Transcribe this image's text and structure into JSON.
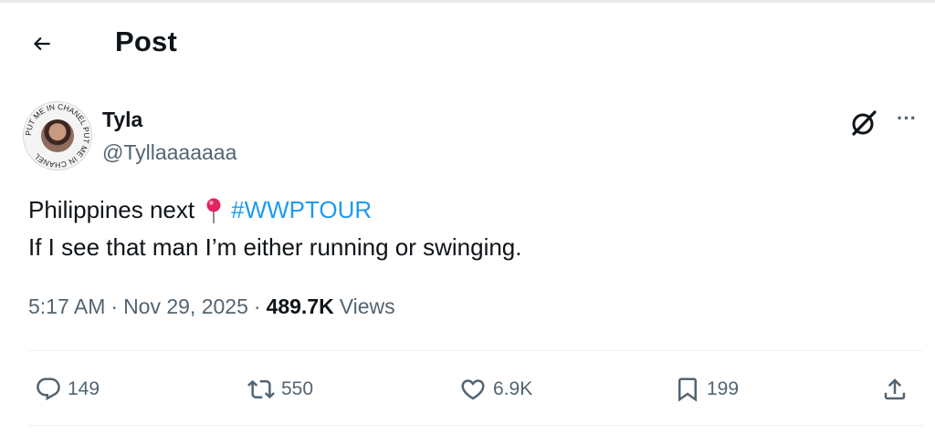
{
  "header": {
    "title": "Post"
  },
  "icons": {
    "back": "arrow-left-icon",
    "grok": "grok-icon",
    "more": "more-icon",
    "reply": "reply-icon",
    "repost": "repost-icon",
    "like": "heart-icon",
    "bookmark": "bookmark-icon",
    "share": "share-icon",
    "pin": "round-pushpin-icon"
  },
  "author": {
    "display_name": "Tyla",
    "handle": "@Tyllaaaaaaa",
    "avatar_ring_text": "PUT ME IN CHANEL PUT ME IN CHANEL"
  },
  "tweet": {
    "line1_text": "Philippines next",
    "hashtag": "#WWPTOUR",
    "line2_text": "If I see that man I’m either running or swinging."
  },
  "meta": {
    "time": "5:17 AM",
    "separator": "·",
    "date": "Nov 29, 2025",
    "views_count": "489.7K",
    "views_label": "Views"
  },
  "actions": {
    "replies": "149",
    "reposts": "550",
    "likes": "6.9K",
    "bookmarks": "199"
  },
  "colors": {
    "text": "#0f1419",
    "secondary": "#536471",
    "link": "#1d9bf0",
    "divider": "#eff3f4",
    "pin": "#e0245e"
  }
}
